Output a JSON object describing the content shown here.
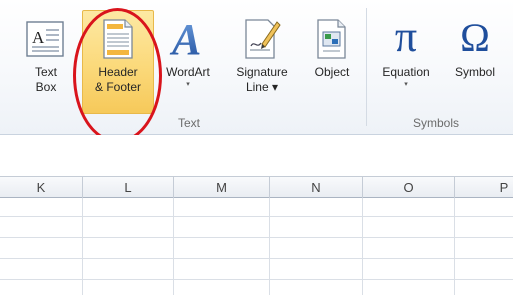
{
  "ribbon": {
    "buttons": {
      "text_box": {
        "label1": "Text",
        "label2": "Box"
      },
      "header_footer": {
        "label1": "Header",
        "label2": "& Footer"
      },
      "wordart": {
        "label1": "WordArt",
        "dropdown": "▾"
      },
      "signature": {
        "label1": "Signature",
        "label2": "Line ▾"
      },
      "object": {
        "label1": "Object"
      },
      "equation": {
        "label1": "Equation",
        "dropdown": "▾",
        "glyph": "π"
      },
      "symbol": {
        "label1": "Symbol",
        "glyph": "Ω"
      }
    },
    "groups": {
      "text": "Text",
      "symbols": "Symbols"
    },
    "highlight": {
      "fill": "#fbd97a",
      "circle_color": "#d9141c"
    }
  },
  "sheet": {
    "columns": [
      "K",
      "L",
      "M",
      "N",
      "O",
      "P"
    ]
  }
}
